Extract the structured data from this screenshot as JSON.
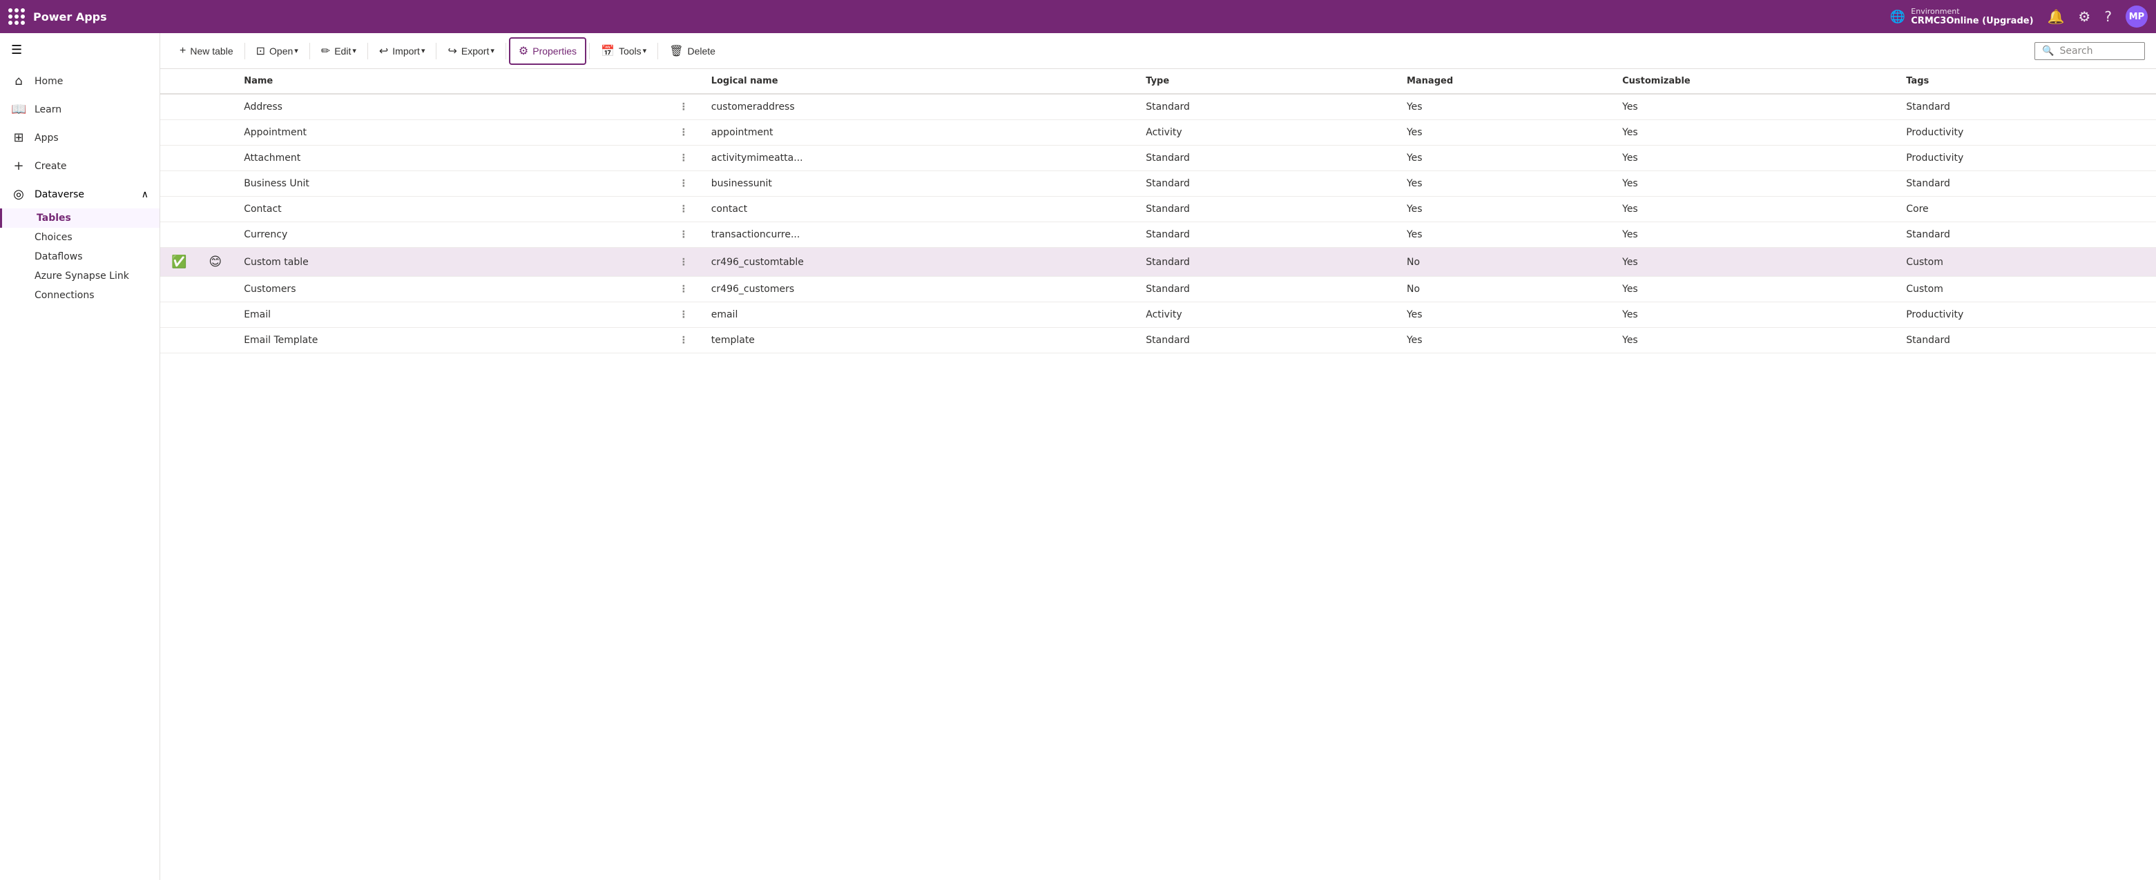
{
  "topbar": {
    "app_name": "Power Apps",
    "environment_label": "Environment",
    "environment_name": "CRMC3Online (Upgrade)",
    "avatar_initials": "MP"
  },
  "sidebar": {
    "hamburger_icon": "☰",
    "items": [
      {
        "id": "home",
        "label": "Home",
        "icon": "⌂"
      },
      {
        "id": "learn",
        "label": "Learn",
        "icon": "📖"
      },
      {
        "id": "apps",
        "label": "Apps",
        "icon": "⊞"
      },
      {
        "id": "create",
        "label": "Create",
        "icon": "+"
      },
      {
        "id": "dataverse",
        "label": "Dataverse",
        "icon": "◎",
        "expanded": true
      }
    ],
    "dataverse_sub": [
      {
        "id": "tables",
        "label": "Tables",
        "active": true
      },
      {
        "id": "choices",
        "label": "Choices"
      },
      {
        "id": "dataflows",
        "label": "Dataflows"
      },
      {
        "id": "azure-synapse",
        "label": "Azure Synapse Link"
      },
      {
        "id": "connections",
        "label": "Connections"
      }
    ]
  },
  "toolbar": {
    "new_table": "New table",
    "open": "Open",
    "edit": "Edit",
    "import": "Import",
    "export": "Export",
    "properties": "Properties",
    "tools": "Tools",
    "delete": "Delete",
    "search_placeholder": "Search"
  },
  "table": {
    "columns": [
      {
        "id": "check",
        "label": ""
      },
      {
        "id": "emoji",
        "label": ""
      },
      {
        "id": "name",
        "label": "Name"
      },
      {
        "id": "menu",
        "label": ""
      },
      {
        "id": "logical_name",
        "label": "Logical name"
      },
      {
        "id": "type",
        "label": "Type"
      },
      {
        "id": "managed",
        "label": "Managed"
      },
      {
        "id": "customizable",
        "label": "Customizable"
      },
      {
        "id": "tags",
        "label": "Tags"
      }
    ],
    "rows": [
      {
        "name": "Address",
        "logical_name": "customeraddress",
        "type": "Standard",
        "managed": "Yes",
        "customizable": "Yes",
        "tags": "Standard",
        "selected": false
      },
      {
        "name": "Appointment",
        "logical_name": "appointment",
        "type": "Activity",
        "managed": "Yes",
        "customizable": "Yes",
        "tags": "Productivity",
        "selected": false
      },
      {
        "name": "Attachment",
        "logical_name": "activitymimeatta...",
        "type": "Standard",
        "managed": "Yes",
        "customizable": "Yes",
        "tags": "Productivity",
        "selected": false
      },
      {
        "name": "Business Unit",
        "logical_name": "businessunit",
        "type": "Standard",
        "managed": "Yes",
        "customizable": "Yes",
        "tags": "Standard",
        "selected": false
      },
      {
        "name": "Contact",
        "logical_name": "contact",
        "type": "Standard",
        "managed": "Yes",
        "customizable": "Yes",
        "tags": "Core",
        "selected": false
      },
      {
        "name": "Currency",
        "logical_name": "transactioncurre...",
        "type": "Standard",
        "managed": "Yes",
        "customizable": "Yes",
        "tags": "Standard",
        "selected": false
      },
      {
        "name": "Custom table",
        "logical_name": "cr496_customtable",
        "type": "Standard",
        "managed": "No",
        "customizable": "Yes",
        "tags": "Custom",
        "selected": true,
        "has_check": true,
        "has_emoji": true
      },
      {
        "name": "Customers",
        "logical_name": "cr496_customers",
        "type": "Standard",
        "managed": "No",
        "customizable": "Yes",
        "tags": "Custom",
        "selected": false
      },
      {
        "name": "Email",
        "logical_name": "email",
        "type": "Activity",
        "managed": "Yes",
        "customizable": "Yes",
        "tags": "Productivity",
        "selected": false
      },
      {
        "name": "Email Template",
        "logical_name": "template",
        "type": "Standard",
        "managed": "Yes",
        "customizable": "Yes",
        "tags": "Standard",
        "selected": false
      }
    ]
  }
}
